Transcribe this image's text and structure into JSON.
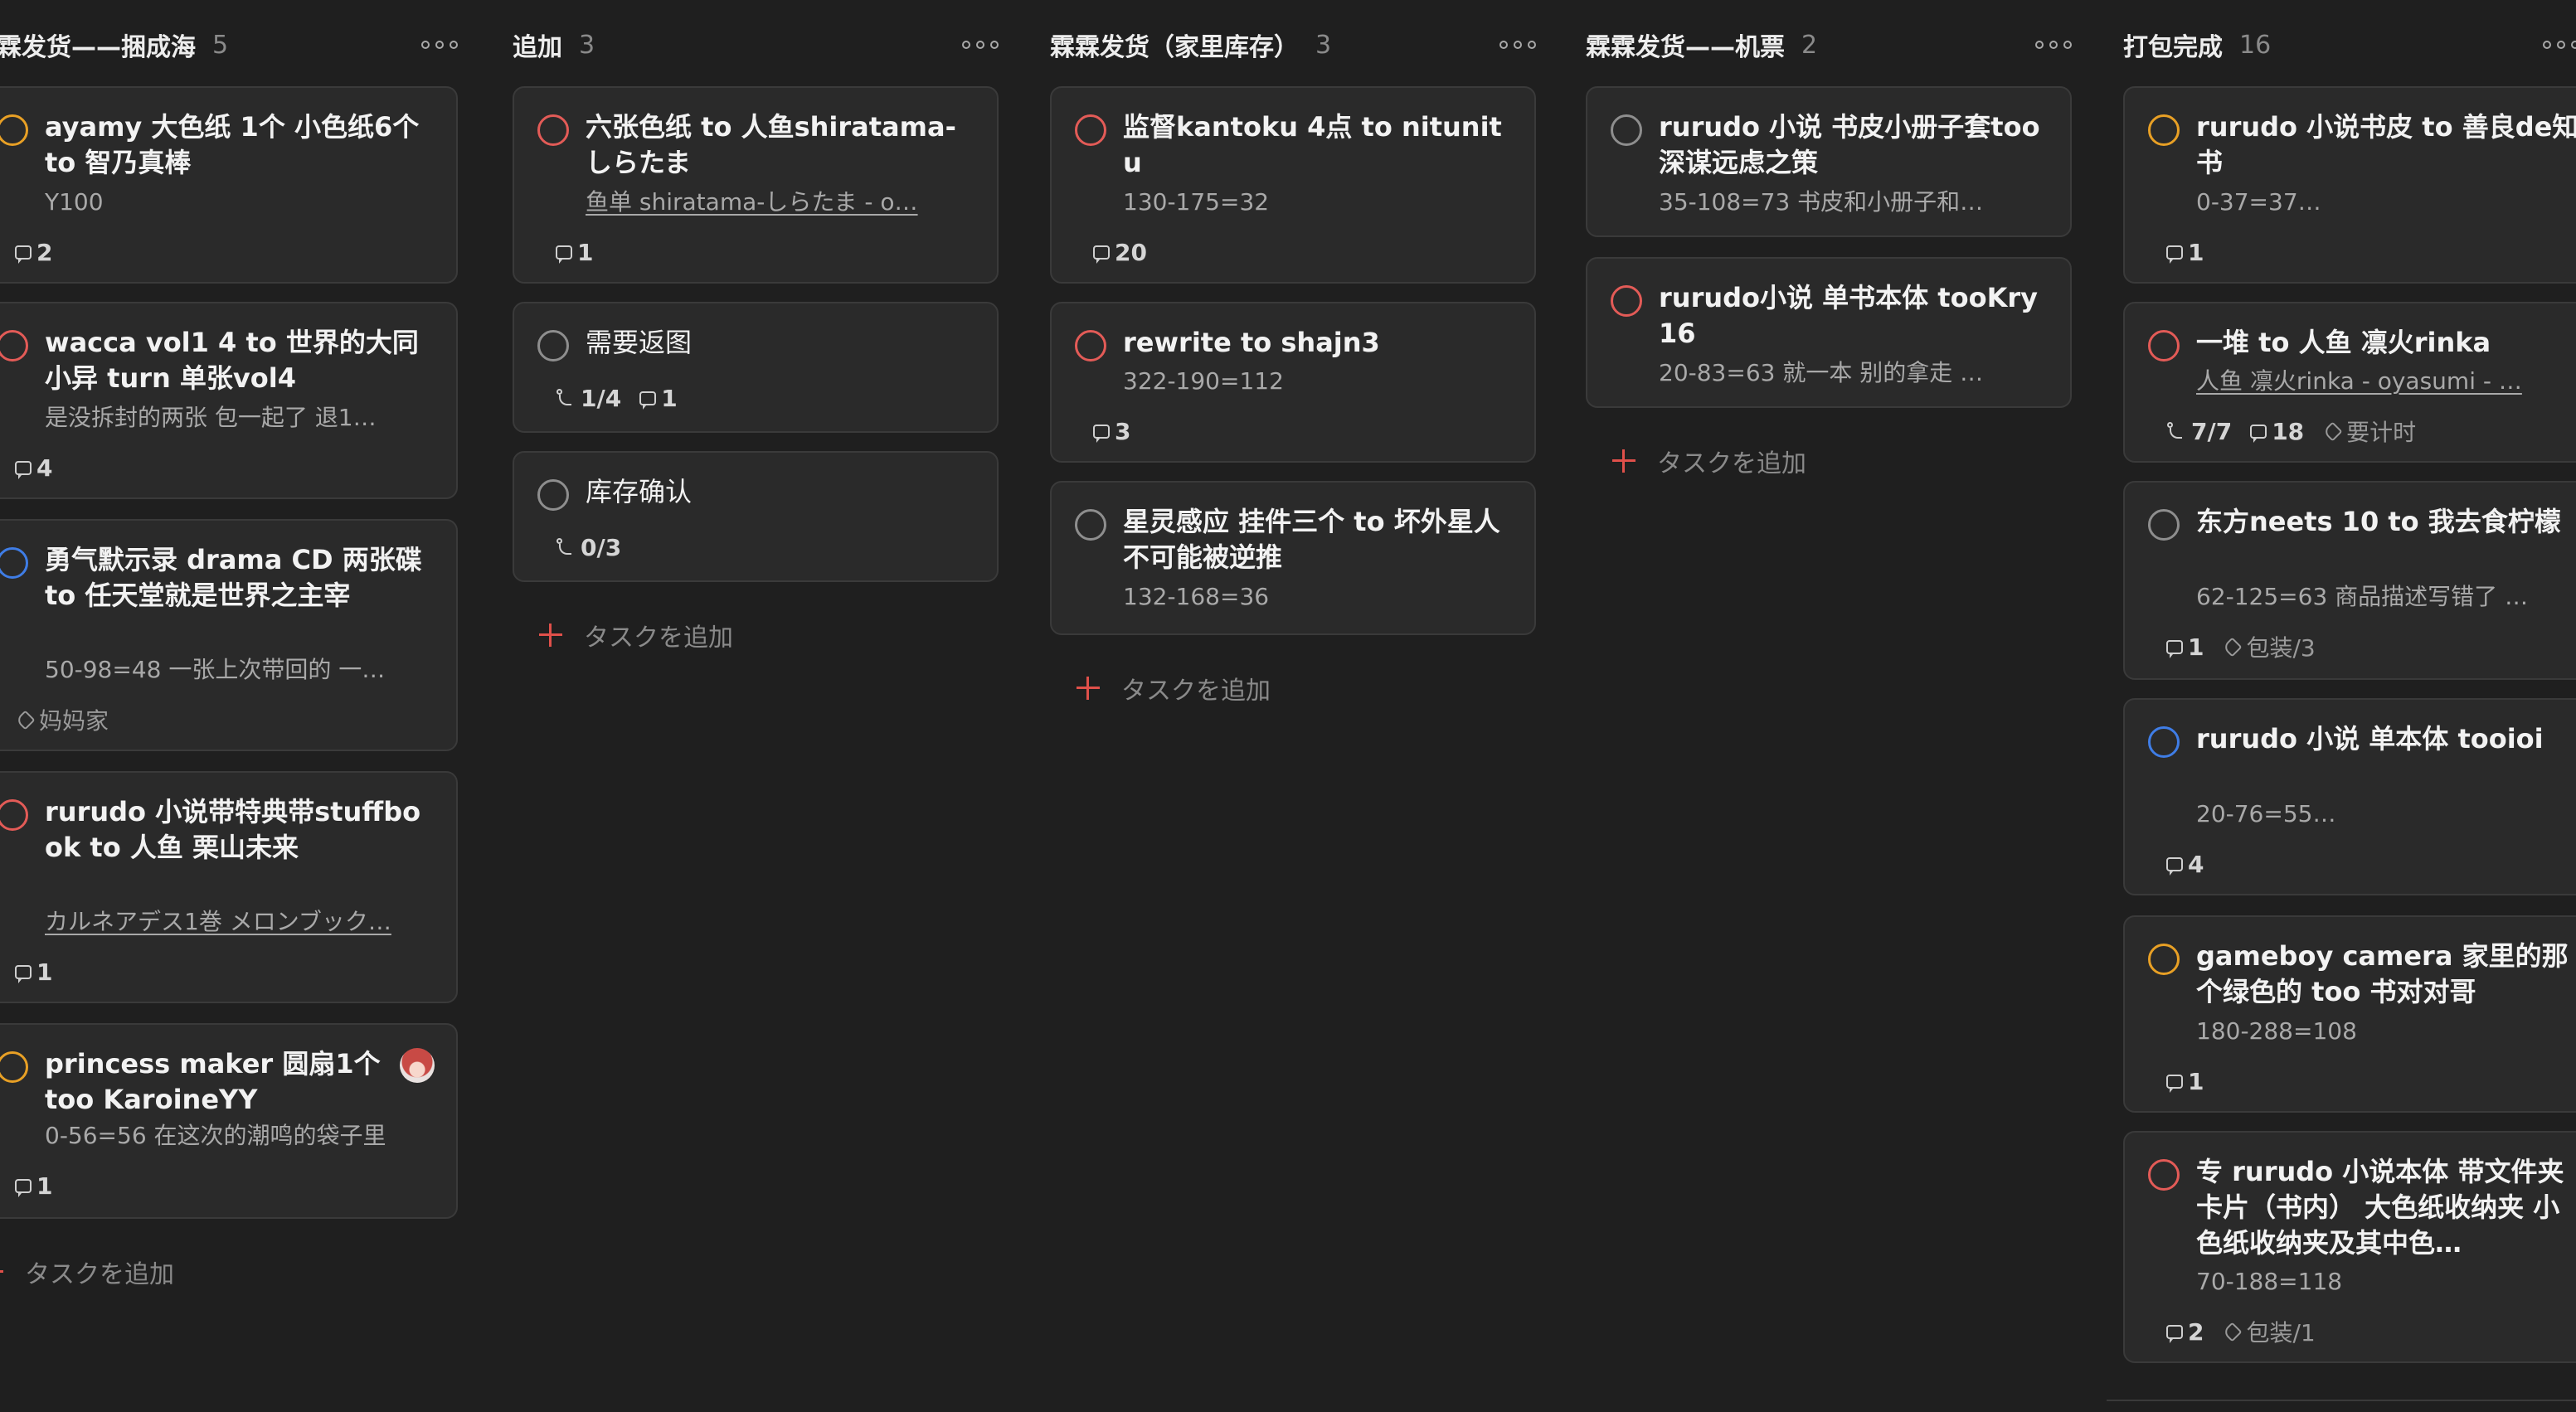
{
  "colors": {
    "background": "#1f1f1f",
    "card": "#2a2a2a",
    "card_border": "#3a3a3a",
    "priority_red": "#e35b57",
    "priority_orange": "#e8a025",
    "priority_blue": "#3f7de6",
    "priority_none": "#8e8e8e",
    "add_plus": "#e0504a"
  },
  "columns": [
    {
      "title": "霖霖发货——捆成海",
      "count": "5",
      "add_label": "タスクを追加",
      "cards": [
        {
          "title": "ayamy 大色纸 1个 小色纸6个 to 智乃真棒",
          "desc": "Y100",
          "priority": "orange",
          "comments": "2"
        },
        {
          "title": "wacca vol1 4 to 世界的大同小异 turn 单张vol4",
          "desc": "是没拆封的两张 包一起了 退1…",
          "priority": "red",
          "comments": "4"
        },
        {
          "title": "勇气默示录 drama CD 两张碟 to 任天堂就是世界之主宰",
          "desc": "50-98=48 一张上次带回的 一…",
          "priority": "blue",
          "label": "妈妈家"
        },
        {
          "title": "rurudo 小说带特典带stuffbook to 人鱼 栗山未来",
          "desc": "カルネアデス1巻 メロンブック…",
          "desc_link": true,
          "priority": "red",
          "comments": "1"
        },
        {
          "title": "princess maker 圆扇1个too KaroineYY",
          "desc": "0-56=56 在这次的潮鸣的袋子里",
          "priority": "orange",
          "comments": "1",
          "avatar": true
        }
      ]
    },
    {
      "title": "追加",
      "count": "3",
      "add_label": "タスクを追加",
      "cards": [
        {
          "title": "六张色纸 to 人鱼shiratama-しらたま",
          "desc": "鱼单 shiratama-しらたま - o…",
          "desc_link": true,
          "priority": "red",
          "comments": "1"
        },
        {
          "title": "需要返图",
          "priority": "none",
          "subtasks": "1/4",
          "comments": "1"
        },
        {
          "title": "库存确认",
          "priority": "none",
          "subtasks": "0/3"
        }
      ]
    },
    {
      "title": "霖霖发货（家里库存）",
      "count": "3",
      "add_label": "タスクを追加",
      "cards": [
        {
          "title": "监督kantoku 4点 to nitunitu",
          "desc": "130-175=32",
          "priority": "red",
          "comments": "20"
        },
        {
          "title": "rewrite to shajn3",
          "desc": "322-190=112",
          "priority": "red",
          "comments": "3"
        },
        {
          "title": "星灵感应 挂件三个 to 坏外星人不可能被逆推",
          "desc": "132-168=36",
          "priority": "none"
        }
      ]
    },
    {
      "title": "霖霖发货——机票",
      "count": "2",
      "add_label": "タスクを追加",
      "cards": [
        {
          "title": "rurudo 小说 书皮小册子套too 深谋远虑之策",
          "desc": "35-108=73 书皮和小册子和…",
          "priority": "none"
        },
        {
          "title": "rurudo小说 单书本体 tooKry16",
          "desc": "20-83=63 就一本 别的拿走 …",
          "priority": "red"
        }
      ]
    },
    {
      "title": "打包完成",
      "count": "16",
      "add_label": "",
      "cards": [
        {
          "title": "rurudo 小说书皮 to 善良de知书",
          "desc": "0-37=37…",
          "priority": "orange",
          "comments": "1"
        },
        {
          "title": "一堆 to 人鱼 凛火rinka",
          "desc": "人鱼 凛火rinka - oyasumi - …",
          "desc_link": true,
          "priority": "red",
          "subtasks": "7/7",
          "comments": "18",
          "label": "要计时"
        },
        {
          "title": "东方neets 10 to 我去食柠檬",
          "desc": "62-125=63 商品描述写错了 …",
          "priority": "none",
          "comments": "1",
          "label": "包装/3"
        },
        {
          "title": "rurudo 小说 单本体 tooioi",
          "desc": "20-76=55…",
          "priority": "blue",
          "comments": "4"
        },
        {
          "title": "gameboy camera 家里的那个绿色的 too 书对对哥",
          "desc": "180-288=108",
          "priority": "orange",
          "comments": "1"
        },
        {
          "title": "专 rurudo 小说本体 带文件夹 卡片（书内） 大色纸收纳夹 小色纸收纳夹及其中色…",
          "desc": "70-188=118",
          "priority": "red",
          "comments": "2",
          "label": "包装/1"
        }
      ]
    }
  ]
}
